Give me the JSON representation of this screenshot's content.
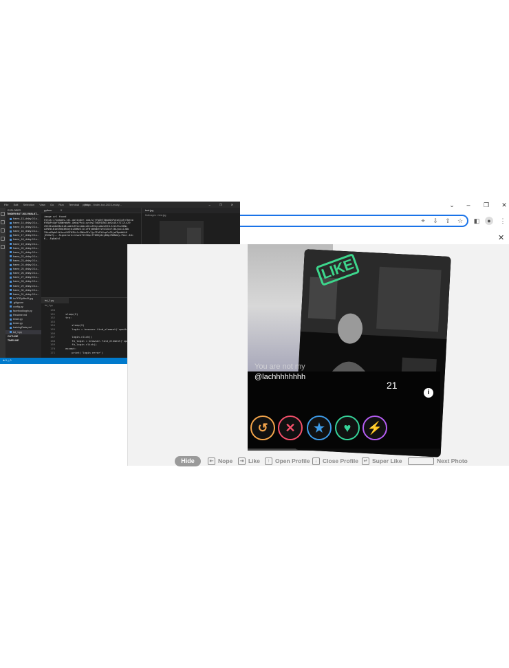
{
  "vscode": {
    "menu": [
      "File",
      "Edit",
      "Selection",
      "View",
      "Go",
      "Run",
      "Terminal",
      "Help"
    ],
    "title": "python - tinder-bot-2023-maby...",
    "explorer_header": "EXPLORER",
    "root_folder": "TINDER BOT 2023 WALKT...",
    "files": [
      "frame_13_delay-0.1s...",
      "frame_14_delay-0.1s...",
      "frame_15_delay-0.1s...",
      "frame_16_delay-0.1s...",
      "frame_17_delay-0.1s...",
      "frame_18_delay-0.1s...",
      "frame_19_delay-0.1s...",
      "frame_20_delay-0.1s...",
      "frame_21_delay-0.1s...",
      "frame_22_delay-0.1s...",
      "frame_23_delay-0.1s...",
      "frame_24_delay-0.1s...",
      "frame_25_delay-0.1s...",
      "frame_26_delay-0.1s...",
      "frame_27_delay-0.1s...",
      "frame_28_delay-0.1s...",
      "frame_29_delay-0.1s...",
      "frame_30_delay-0.1s...",
      "frame_31_delay-0.1s...",
      "ko7f7f3y8bs0f.jpg",
      ".gitignore",
      "config.py",
      "facebooklogin.py",
      "Readme.md",
      "tester.py",
      "tester.py",
      "trainingData.yml",
      "tst_1.py"
    ],
    "outline": "OUTLINE",
    "timeline": "TIMELINE",
    "terminal_tab": "python",
    "terminal_lines": [
      "image url found",
      "https://images-ssl.gotinder.com/u/rYpXhT3bkdQnPutoCCpTv7beco",
      "KYBpPcugfVUaWrWpRt.webp?Policy=eyJTdGF0ZW1lbnQiOlt7IlJlc29",
      "ZSI6Imh0dHBzOi8vaW1hZ2VzLWdvdGluZGVyLmNvbS91L3JZcFhoVDNi",
      "a2RRblB1dG9DQ3BUdjdiZWNvS1lCcFBjdWdmVlVhV3JXcFJ0LyoiLCJDb",
      "25kaXRpb24iOnsiRGF0ZUxlc3NUaGFuIjp7IkFXUzpFcG9jaFRpbWUiO",
      "jE2NzYy...Signature=rewzk7t3lDpcfT0HSy0cyDOgrRB&Key-Pair-Id=",
      "K...FgOaUxl"
    ],
    "preview_tab": "test.jpg",
    "preview_crumb": "fbdimages > test.jpg",
    "editor_tab": "tst_1.py",
    "editor_crumb": "tst_1.py",
    "code_lines": [
      {
        "n": "160",
        "t": ""
      },
      {
        "n": "161",
        "t": "    sleep(2)"
      },
      {
        "n": "162",
        "t": "    try:"
      },
      {
        "n": "163",
        "t": ""
      },
      {
        "n": "164",
        "t": "        sleep(2)"
      },
      {
        "n": "165",
        "t": "        login = browser.find_element('xpath', '/html/body/div[1]/div/div[1]/div/main/div[1]/div/div/div/"
      },
      {
        "n": "166",
        "t": ""
      },
      {
        "n": "167",
        "t": "        login.click()"
      },
      {
        "n": "168",
        "t": "        fb_login = browser.find_element('xpath', '/html/body/div[2]/main/div/div/div[1]/div/div/div[3]"
      },
      {
        "n": "169",
        "t": "        fb_login.click()"
      },
      {
        "n": "170",
        "t": "    except:"
      },
      {
        "n": "171",
        "t": "        print('login error')"
      }
    ],
    "status": "⊗ 0 △ 0"
  },
  "chrome": {
    "window_controls": [
      "⌄",
      "–",
      "❐",
      "✕"
    ],
    "toolbar_icons": [
      "location-pin-icon",
      "install-icon",
      "share-icon",
      "bookmark-star-icon",
      "side-panel-icon",
      "profile-icon",
      "menu-kebab-icon"
    ]
  },
  "card": {
    "stamp": "LIKE",
    "bio": "You are not my",
    "handle": "@lachhhhhhhh",
    "age": "21",
    "info": "i"
  },
  "actions": [
    {
      "name": "rewind",
      "glyph": "↺"
    },
    {
      "name": "nope",
      "glyph": "✕"
    },
    {
      "name": "super-like",
      "glyph": "★"
    },
    {
      "name": "like",
      "glyph": "♥"
    },
    {
      "name": "boost",
      "glyph": "⚡"
    }
  ],
  "hints": {
    "hide": "Hide",
    "nope": "Nope",
    "like": "Like",
    "open_profile": "Open Profile",
    "close_profile": "Close Profile",
    "super_like": "Super Like",
    "next_photo": "Next Photo"
  },
  "colors": {
    "vscode_accent": "#007acc",
    "omnibox_focus": "#1a73e8",
    "like_green": "#3dd68c",
    "nope_red": "#f5506b",
    "rewind_orange": "#f4a54b",
    "super_blue": "#3e9be8",
    "boost_purple": "#b45cf2"
  }
}
